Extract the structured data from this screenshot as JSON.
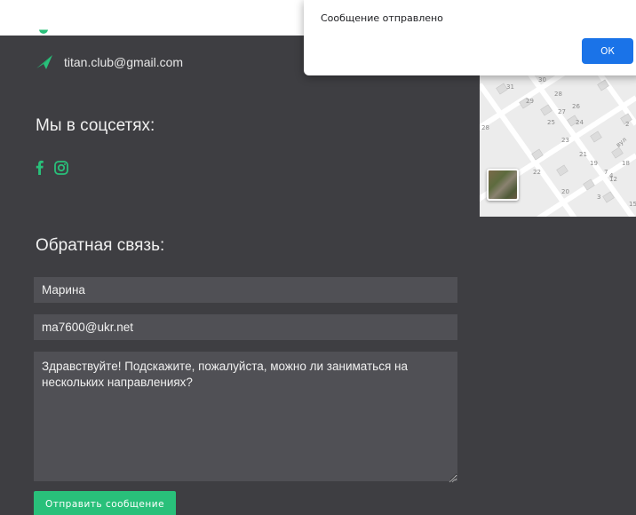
{
  "contacts": {
    "email": "titan.club@gmail.com"
  },
  "social": {
    "heading": "Мы в соцсетях:",
    "icons": [
      "facebook-icon",
      "instagram-icon"
    ]
  },
  "feedback": {
    "heading": "Обратная связь:",
    "name_value": "Марина",
    "email_value": "ma7600@ukr.net",
    "message_value": "Здравствуйте! Подскажите, пожалуйста, можно ли заниматься на нескольких направлениях?",
    "submit_label": "Отправить сообщение"
  },
  "alert": {
    "message": "Сообщение отправлено",
    "ok_label": "ОК"
  },
  "map": {
    "labels": [
      "31",
      "30",
      "29",
      "28",
      "27",
      "26",
      "25",
      "24",
      "23",
      "28",
      "22",
      "21",
      "20",
      "19",
      "18",
      "4",
      "3",
      "12",
      "15",
      "2",
      "7",
      "вул"
    ]
  },
  "colors": {
    "accent": "#29c07a",
    "panel_bg": "#3e3e42",
    "field_bg": "#505055",
    "dialog_button": "#1a73e8"
  }
}
